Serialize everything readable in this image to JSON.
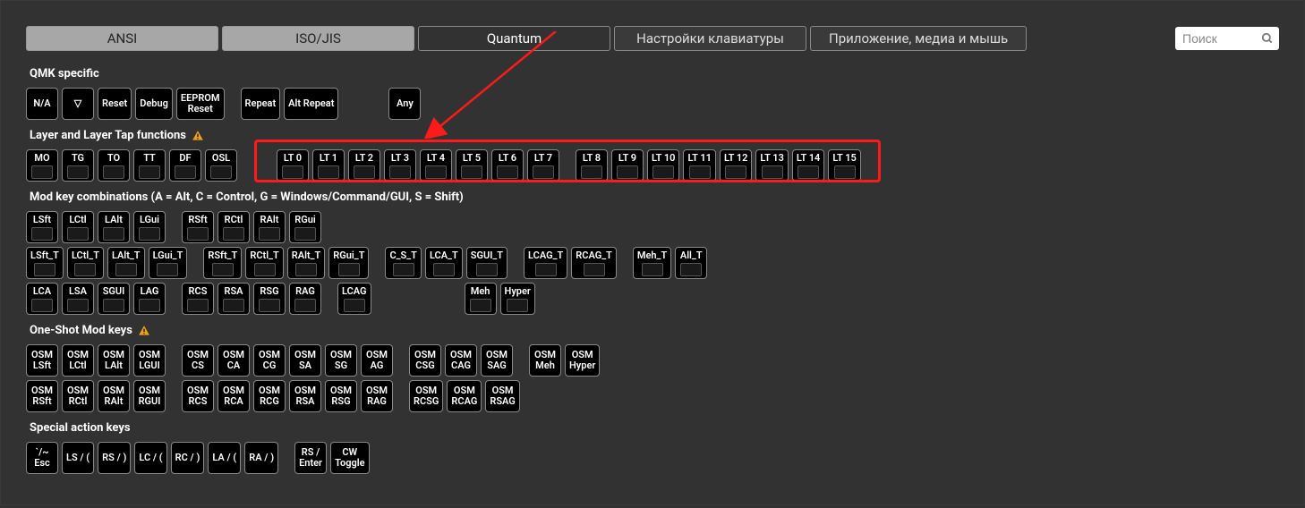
{
  "tabs": {
    "ansi": "ANSI",
    "iso": "ISO/JIS",
    "quantum": "Quantum",
    "kb_settings": "Настройки клавиатуры",
    "app_media": "Приложение, медиа и мышь"
  },
  "search_placeholder": "Поиск",
  "sections": {
    "qmk": "QMK specific",
    "layer": "Layer and Layer Tap functions",
    "mod": "Mod key combinations (A = Alt, C = Control, G = Windows/Command/GUI, S = Shift)",
    "oneshot": "One-Shot Mod keys",
    "special": "Special action keys"
  },
  "qmk_keys": [
    "N/A",
    "▽",
    "Reset",
    "Debug",
    "EEPROM\nReset",
    "Repeat",
    "Alt Repeat"
  ],
  "qmk_any": "Any",
  "layer_basic": [
    "MO",
    "TG",
    "TO",
    "TT",
    "DF",
    "OSL"
  ],
  "layer_tap": [
    "LT 0",
    "LT 1",
    "LT 2",
    "LT 3",
    "LT 4",
    "LT 5",
    "LT 6",
    "LT 7",
    "LT 8",
    "LT 9",
    "LT 10",
    "LT 11",
    "LT 12",
    "LT 13",
    "LT 14",
    "LT 15"
  ],
  "mod_r1_a": [
    "LSft",
    "LCtl",
    "LAlt",
    "LGui"
  ],
  "mod_r1_b": [
    "RSft",
    "RCtl",
    "RAlt",
    "RGui"
  ],
  "mod_r2_a": [
    "LSft_T",
    "LCtl_T",
    "LAlt_T",
    "LGui_T"
  ],
  "mod_r2_b": [
    "RSft_T",
    "RCtl_T",
    "RAlt_T",
    "RGui_T"
  ],
  "mod_r2_c": [
    "C_S_T",
    "LCA_T",
    "SGUI_T"
  ],
  "mod_r2_d": [
    "LCAG_T",
    "RCAG_T"
  ],
  "mod_r2_e": [
    "Meh_T",
    "All_T"
  ],
  "mod_r3_a": [
    "LCA",
    "LSA",
    "SGUI",
    "LAG"
  ],
  "mod_r3_b": [
    "RCS",
    "RSA",
    "RSG",
    "RAG"
  ],
  "mod_r3_c": [
    "LCAG"
  ],
  "mod_r3_d": [
    "Meh",
    "Hyper"
  ],
  "osm_r1_a": [
    "OSM\nLSft",
    "OSM\nLCtl",
    "OSM\nLAlt",
    "OSM\nLGUI"
  ],
  "osm_r1_b": [
    "OSM\nCS",
    "OSM\nCA",
    "OSM\nCG",
    "OSM\nSA",
    "OSM\nSG",
    "OSM\nAG"
  ],
  "osm_r1_c": [
    "OSM\nCSG",
    "OSM\nCAG",
    "OSM\nSAG"
  ],
  "osm_r1_d": [
    "OSM\nMeh",
    "OSM\nHyper"
  ],
  "osm_r2_a": [
    "OSM\nRSft",
    "OSM\nRCtl",
    "OSM\nRAlt",
    "OSM\nRGUI"
  ],
  "osm_r2_b": [
    "OSM\nRCS",
    "OSM\nRCA",
    "OSM\nRCG",
    "OSM\nRSA",
    "OSM\nRSG",
    "OSM\nRAG"
  ],
  "osm_r2_c": [
    "OSM\nRCSG",
    "OSM\nRCAG",
    "OSM\nRSAG"
  ],
  "special_keys": [
    "`/~\nEsc",
    "LS / (",
    "RS / )",
    "LC / (",
    "RC / )",
    "LA / (",
    "RA / )",
    "RS /\nEnter",
    "CW\nToggle"
  ]
}
